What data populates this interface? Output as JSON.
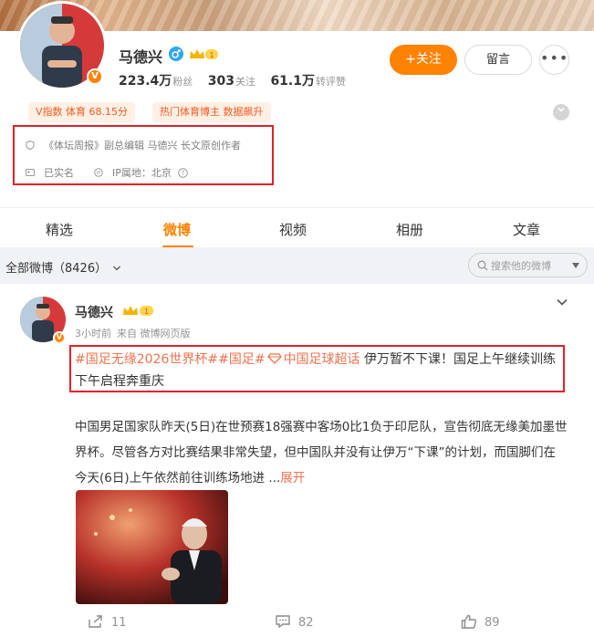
{
  "profile": {
    "name": "马德兴",
    "verified_badge": "V",
    "followers_value": "223.4万",
    "followers_label": "粉丝",
    "following_value": "303",
    "following_label": "关注",
    "reposts_value": "61.1万",
    "reposts_label": "转评赞",
    "follow_button": "+关注",
    "message_button": "留言",
    "more_button": "•••",
    "tag_v_index": "V指数 体育 68.15分",
    "tag_hot": "热门体育博主 数据飙升",
    "bio": "《体坛周报》副总编辑 马德兴 长文原创作者",
    "real_name": "已实名",
    "ip_location": "IP属地：北京",
    "accent_color": "#ff8200"
  },
  "tabs": [
    {
      "label": "精选"
    },
    {
      "label": "微博"
    },
    {
      "label": "视频"
    },
    {
      "label": "相册"
    },
    {
      "label": "文章"
    }
  ],
  "filter": {
    "all_label": "全部微博（8426）",
    "search_placeholder": "搜索他的微博"
  },
  "post": {
    "author": "马德兴",
    "time": "3小时前",
    "source": "来自 微博网页版",
    "topic1": "#国足无缘2026世界杯#",
    "topic2": "#国足#",
    "topic3": "中国足球超话",
    "headline": " 伊万暂不下课！国足上午继续训练 下午启程奔重庆",
    "body": "中国男足国家队昨天(5日)在世预赛18强赛中客场0比1负于印尼队，宣告彻底无缘美加墨世界杯。尽管各方对比赛结果非常失望，但中国队并没有让伊万“下课”的计划，而国脚们在今天(6日)上午依然前往训练场地进  ...",
    "more_link": "展开",
    "repost_count": "11",
    "comment_count": "82",
    "like_count": "89"
  }
}
